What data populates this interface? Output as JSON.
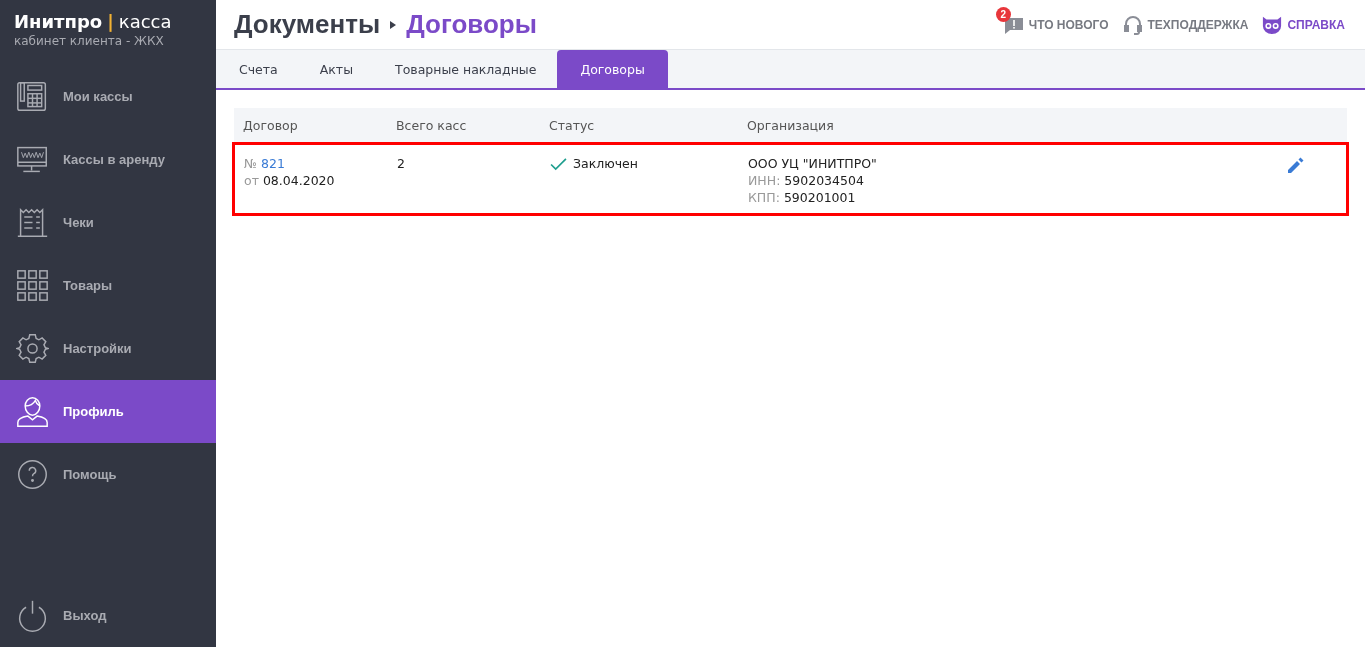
{
  "brand": {
    "name": "Инитпро",
    "separator": "|",
    "product": "касса",
    "subtitle": "кабинет клиента - ЖКХ"
  },
  "sidebar": {
    "items": [
      {
        "kind": "register",
        "label": "Мои кассы",
        "selected": false
      },
      {
        "kind": "monitor",
        "label": "Кассы в аренду",
        "selected": false
      },
      {
        "kind": "receipt",
        "label": "Чеки",
        "selected": false
      },
      {
        "kind": "grid",
        "label": "Товары",
        "selected": false
      },
      {
        "kind": "gear",
        "label": "Настройки",
        "selected": false
      },
      {
        "kind": "person",
        "label": "Профиль",
        "selected": true
      },
      {
        "kind": "help",
        "label": "Помощь",
        "selected": false
      }
    ],
    "logout": {
      "label": "Выход"
    }
  },
  "breadcrumb": {
    "parent": "Документы",
    "current": "Договоры"
  },
  "top_links": [
    {
      "kind": "news",
      "label": "ЧТО НОВОГО",
      "badge": "2"
    },
    {
      "kind": "support",
      "label": "ТЕХПОДДЕРЖКА"
    },
    {
      "kind": "help",
      "label": "СПРАВКА"
    }
  ],
  "tabs": [
    {
      "label": "Счета",
      "selected": false
    },
    {
      "label": "Акты",
      "selected": false
    },
    {
      "label": "Товарные накладные",
      "selected": false
    },
    {
      "label": "Договоры",
      "selected": true
    }
  ],
  "table": {
    "columns": [
      "Договор",
      "Всего касс",
      "Статус",
      "Организация"
    ],
    "rows": [
      {
        "highlighted": true,
        "number_label": "№",
        "number": "821",
        "date_label": "от",
        "date": "08.04.2020",
        "registers": "2",
        "status": "Заключен",
        "status_ok": true,
        "org": "ООО УЦ \"ИНИТПРО\"",
        "inn_label": "ИНН:",
        "inn": "5902034504",
        "kpp_label": "КПП:",
        "kpp": "590201001"
      }
    ]
  }
}
